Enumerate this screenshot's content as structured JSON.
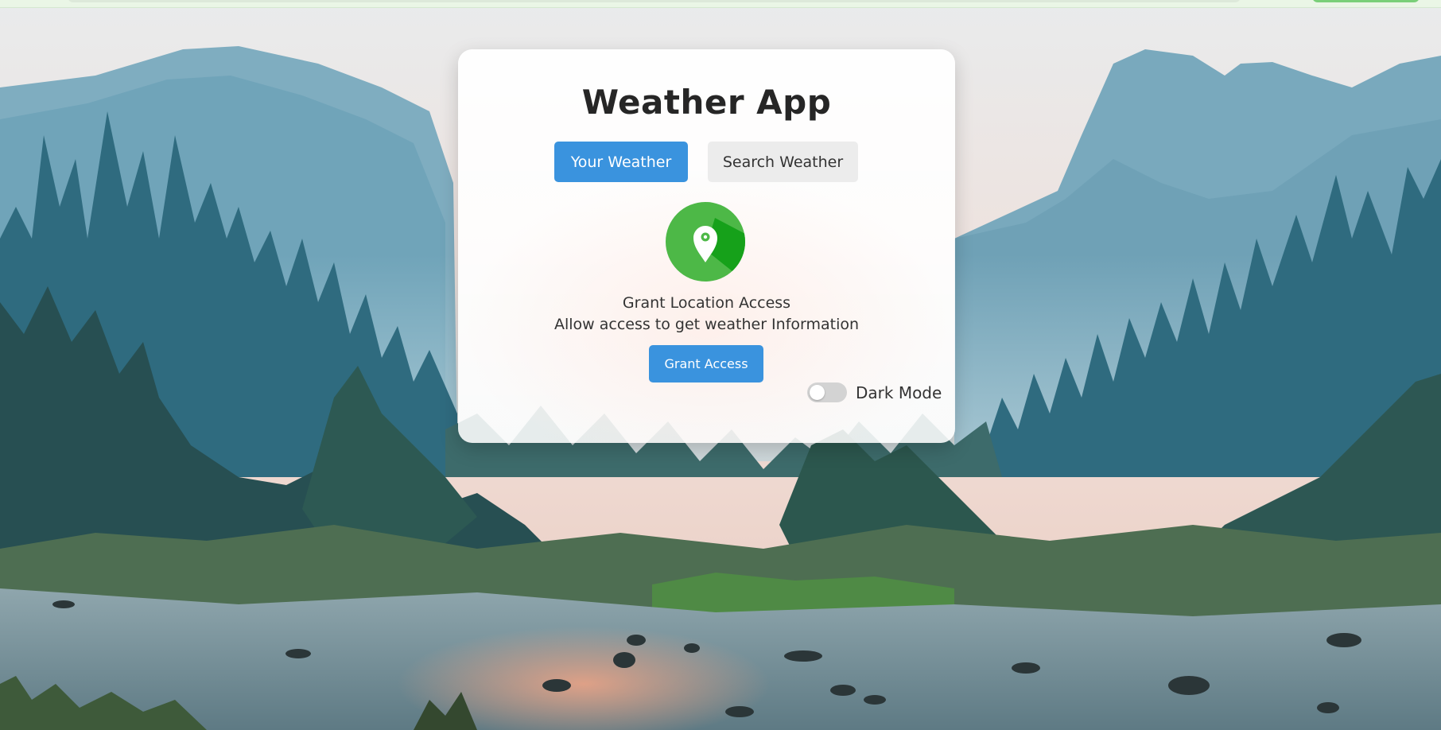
{
  "app": {
    "title": "Weather App"
  },
  "tabs": [
    {
      "label": "Your Weather",
      "active": true
    },
    {
      "label": "Search Weather",
      "active": false
    }
  ],
  "grant_location": {
    "icon": "location-pin-icon",
    "title": "Grant Location Access",
    "description": "Allow access to get weather Information",
    "button_label": "Grant Access"
  },
  "dark_mode": {
    "label": "Dark Mode",
    "enabled": false
  },
  "background": {
    "scene": "mountain-forest-river-landscape"
  },
  "colors": {
    "accent": "#3a93de",
    "inactive_tab": "#ececec",
    "icon_green": "#4db847",
    "icon_green_dark": "#16a11a",
    "toggle_off": "#d3d3d3"
  }
}
